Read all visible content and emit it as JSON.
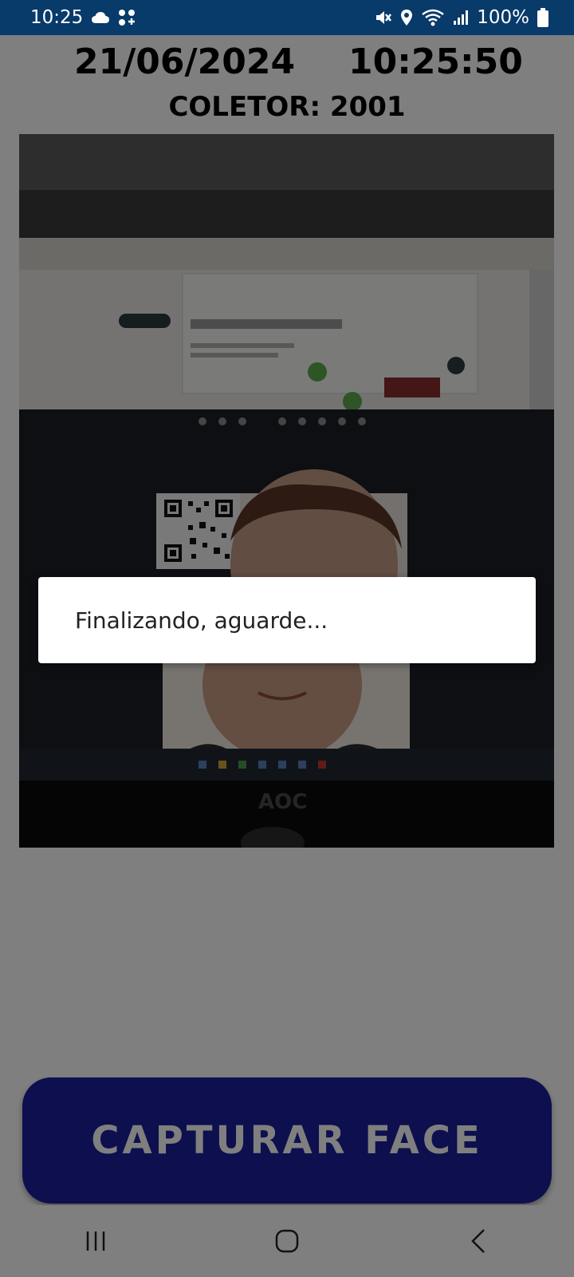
{
  "status_bar": {
    "time": "10:25",
    "battery": "100%",
    "background": "#083a6a",
    "icons": [
      "cloud-icon",
      "apps-icon",
      "mute-icon",
      "location-icon",
      "wifi-icon",
      "signal-icon",
      "battery-icon"
    ]
  },
  "header": {
    "date": "21/06/2024",
    "time": "10:25:50",
    "collector": "COLETOR: 2001"
  },
  "camera": {
    "description_icon": "camera-preview"
  },
  "capture_button": {
    "label": "CAPTURAR FACE",
    "color": "#1c1f9c"
  },
  "dialog": {
    "message": "Finalizando, aguarde..."
  },
  "nav_bar": {
    "icons": [
      "recents-icon",
      "home-icon",
      "back-icon"
    ]
  }
}
